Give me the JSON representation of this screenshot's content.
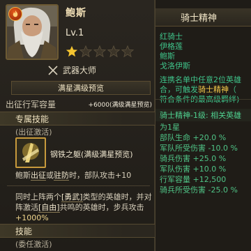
{
  "hero": {
    "name": "鲍斯",
    "level": "Lv.1",
    "stars_filled": 1,
    "stars_total": 5,
    "specialty": "武器大师"
  },
  "preview_button": "满星满级预览",
  "stat": {
    "label": "出征行军容量",
    "value": "+6000(满级满星预览)"
  },
  "special_skill": {
    "header": "专属技能",
    "sub": "(出征激活)",
    "name": "钢铁之躯(满级满星预览)",
    "desc1_a": "鲍斯",
    "desc1_b": "出征",
    "desc1_c": "或",
    "desc1_d": "驻防",
    "desc1_e": "时，部队攻击+10",
    "desc2_a": "同时上阵两个",
    "desc2_b": "[勇武]",
    "desc2_c": "类型的英雄时，并对阵激活",
    "desc2_d": "[自由]",
    "desc2_e": "共鸣的英雄时，步兵攻击",
    "desc2_f": "+1000%"
  },
  "skill": {
    "header": "技能",
    "sub": "(委任激活)"
  },
  "tooltip": {
    "title": "骑士精神",
    "names": [
      "红骑士",
      "伊格莲",
      "鲍斯",
      "戈洛伊斯"
    ],
    "desc_l1": "连携名单中任意2位英雄",
    "desc_l2a": "合，可触发",
    "desc_l2b": "骑士精神",
    "desc_l2c": "（",
    "desc_l3": "符合条件的最高级羁绊)",
    "bonus_header": "骑士精神-1级: 相关英雄",
    "bonus_sub": "为1星",
    "bonuses": [
      "部队生命 +20.0 %",
      "军队所受伤害 -10.0 %",
      "骑兵伤害 +25.0 %",
      "军队伤害 +10.0 %",
      "行军容量 +12,500",
      "骑兵所受伤害 -25.0 %"
    ]
  },
  "colors": {
    "gold_accent": "#f2c84a",
    "green_text": "#4fc386",
    "badge_orange": "#e55a1b"
  },
  "icons": {
    "class_badge": "flame-badge-icon",
    "specialty": "crossed-swords-icon",
    "star": "star-icon"
  }
}
